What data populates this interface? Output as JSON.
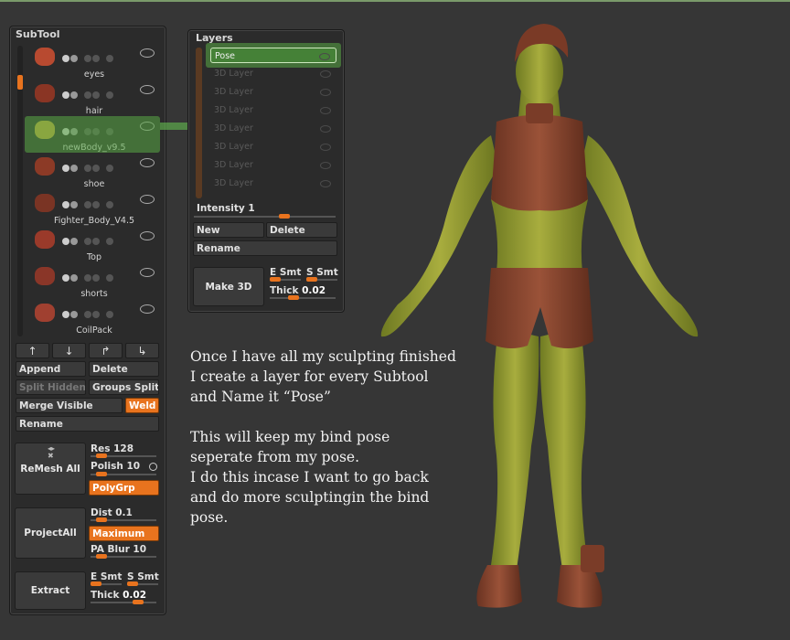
{
  "subtool": {
    "title": "SubTool",
    "items": [
      {
        "name": "eyes"
      },
      {
        "name": "hair"
      },
      {
        "name": "newBody_v9.5",
        "selected": true
      },
      {
        "name": "shoe"
      },
      {
        "name": "Fighter_Body_V4.5"
      },
      {
        "name": "Top"
      },
      {
        "name": "shorts"
      },
      {
        "name": "CoilPack"
      }
    ],
    "arrows": [
      "↑",
      "↓",
      "↱",
      "↳"
    ],
    "append": "Append",
    "delete": "Delete",
    "split_hidden": "Split Hidden",
    "groups_split": "Groups Split",
    "merge_visible": "Merge Visible",
    "weld": "Weld",
    "rename": "Rename",
    "remesh_all": "ReMesh All",
    "res": "Res 128",
    "polish": "Polish 10",
    "polygrp": "PolyGrp",
    "project_all": "ProjectAll",
    "dist": "Dist 0.1",
    "maximum": "Maximum",
    "pa_blur": "PA  Blur 10",
    "extract": "Extract",
    "e_smt": "E Smt",
    "s_smt": "S  Smt",
    "thick_label": "Thick",
    "thick_value": "0.02",
    "colors": {
      "accent": "#e8731e",
      "selection": "#5a9a4a"
    }
  },
  "layers": {
    "title": "Layers",
    "rows": [
      "Pose",
      "3D  Layer",
      "3D  Layer",
      "3D  Layer",
      "3D  Layer",
      "3D  Layer",
      "3D  Layer",
      "3D  Layer"
    ],
    "intensity_label": "Intensity",
    "intensity_value": "1",
    "new": "New",
    "delete": "Delete",
    "rename": "Rename",
    "make3d": "Make 3D",
    "e_smt": "E Smt",
    "s_smt": "S  Smt",
    "thick_label": "Thick",
    "thick_value": "0.02"
  },
  "description": {
    "p1": [
      "Once I have all my sculpting finished",
      " I create a layer for every Subtool",
      "and Name it “Pose”"
    ],
    "p2": [
      "This will keep my bind pose",
      "seperate from my pose.",
      "I do this incase I want to go back",
      "and do more sculptingin the bind",
      "pose."
    ]
  }
}
